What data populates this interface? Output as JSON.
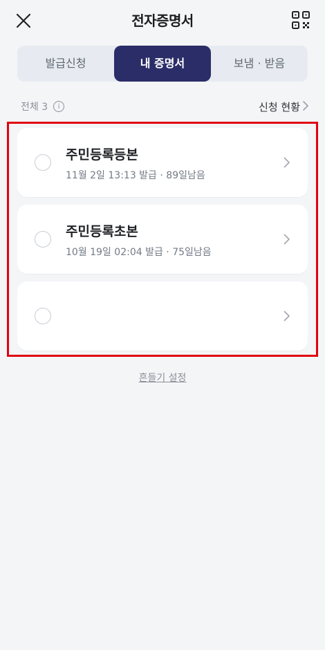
{
  "header": {
    "title": "전자증명서",
    "close_icon": "close-icon",
    "qr_icon": "qr-code-icon"
  },
  "tabs": [
    {
      "label": "발급신청",
      "active": false
    },
    {
      "label": "내 증명서",
      "active": true
    },
    {
      "label": "보냄 · 받음",
      "active": false
    }
  ],
  "summary": {
    "total_label": "전체 3",
    "info_icon": "info-icon",
    "status_link": "신청 현황"
  },
  "documents": [
    {
      "title": "주민등록등본",
      "subtitle": "11월 2일 13:13 발급 · 89일남음"
    },
    {
      "title": "주민등록초본",
      "subtitle": "10월 19일 02:04 발급 · 75일남음"
    },
    {
      "title": "",
      "subtitle": ""
    }
  ],
  "footer": {
    "shake_settings": "흔들기 설정"
  },
  "colors": {
    "background": "#f4f5f7",
    "tab_active": "#2b2d68",
    "highlight_border": "#e10010"
  }
}
